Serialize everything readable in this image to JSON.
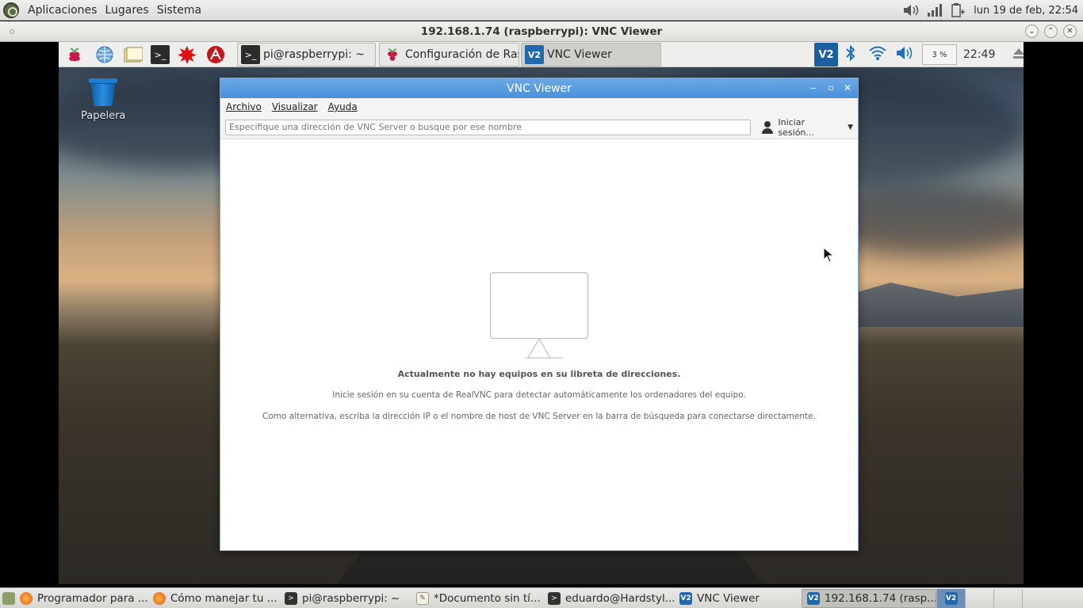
{
  "host_top": {
    "menus": [
      "Aplicaciones",
      "Lugares",
      "Sistema"
    ],
    "clock": "lun 19 de feb, 22:54"
  },
  "vnc_window": {
    "title": "192.168.1.74 (raspberrypi): VNC Viewer"
  },
  "remote_panel": {
    "tasks": [
      {
        "label": "pi@raspberrypi: ~"
      },
      {
        "label": "Configuración de Ras..."
      },
      {
        "label": "VNC Viewer"
      }
    ],
    "cpu": "3 %",
    "clock": "22:49"
  },
  "desktop": {
    "trash_label": "Papelera"
  },
  "app": {
    "title": "VNC Viewer",
    "menu": [
      "Archivo",
      "Visualizar",
      "Ayuda"
    ],
    "search_placeholder": "Especifique una dirección de VNC Server o busque por ese nombre",
    "login_label": "Iniciar sesión...",
    "empty_title": "Actualmente no hay equipos en su libreta de direcciones.",
    "empty_line1": "Inicie sesión en su cuenta de RealVNC para detectar automáticamente los ordenadores del equipo.",
    "empty_line2": "Como alternativa, escriba la dirección IP o el nombre de host de VNC Server en la barra de búsqueda para conectarse directamente."
  },
  "host_bottom": {
    "tasks": [
      {
        "label": "Programador para ...",
        "icon": "firefox-icon"
      },
      {
        "label": "Cómo manejar tu ...",
        "icon": "firefox-icon"
      },
      {
        "label": "pi@raspberrypi: ~",
        "icon": "terminal-icon"
      },
      {
        "label": "*Documento sin tí...",
        "icon": "text-editor-icon"
      },
      {
        "label": "eduardo@Hardstyl...",
        "icon": "terminal-icon"
      },
      {
        "label": "VNC Viewer",
        "icon": "vnc-icon"
      },
      {
        "label": "192.168.1.74 (rasp...",
        "icon": "vnc-icon"
      }
    ]
  },
  "colors": {
    "app_titlebar": "#4a90d9",
    "vnc_brand": "#2268ad",
    "selected_workspace": "#6c8fb7"
  }
}
